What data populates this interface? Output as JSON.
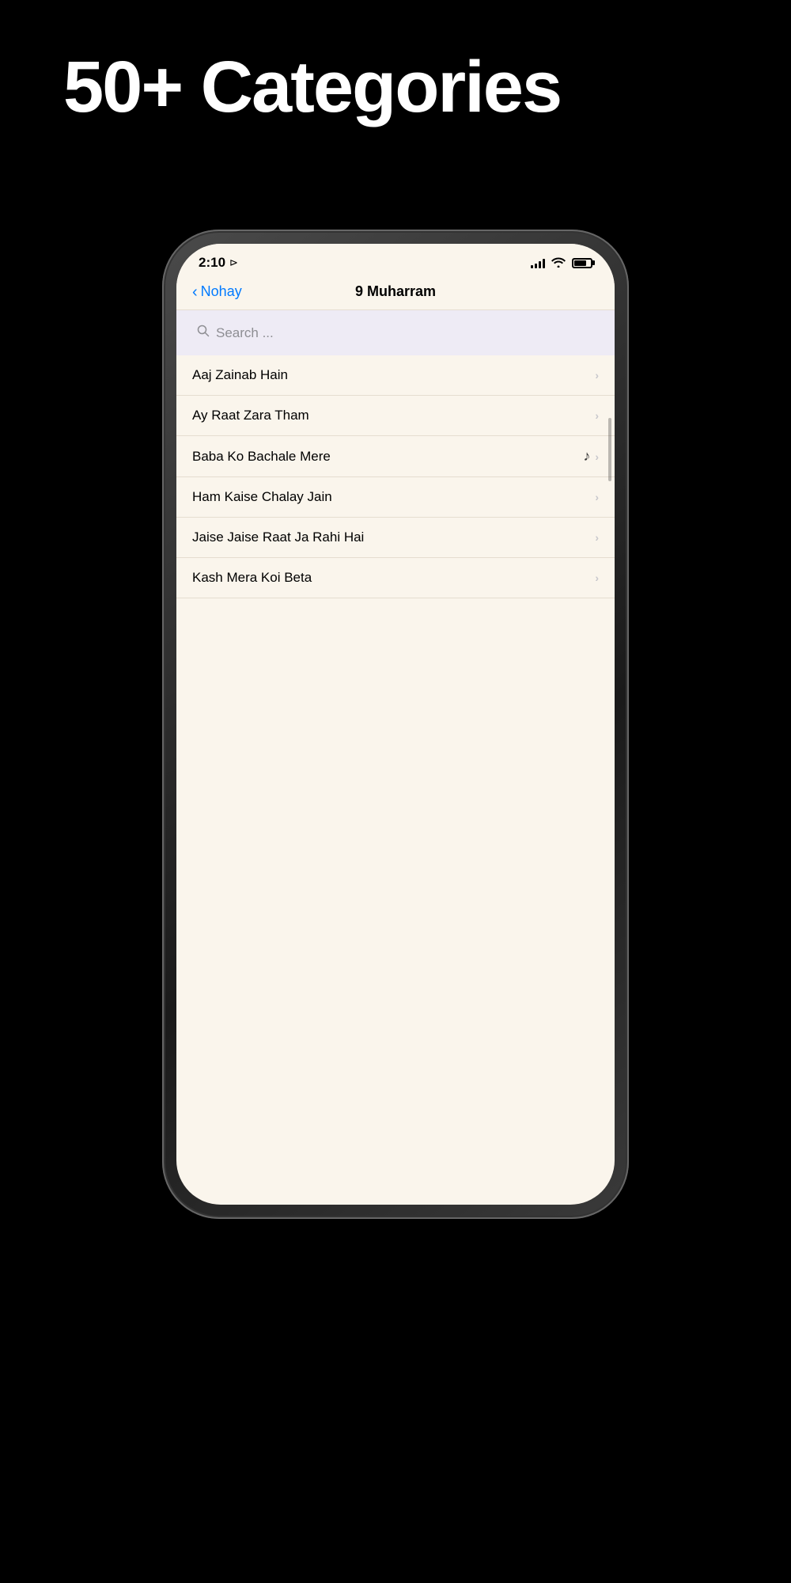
{
  "hero": {
    "title": "50+ Categories"
  },
  "status_bar": {
    "time": "2:10",
    "location_icon": "◂",
    "signal_bars": [
      4,
      6,
      9,
      11,
      14
    ],
    "wifi": "wifi",
    "battery": "battery"
  },
  "nav": {
    "back_label": "Nohay",
    "title": "9 Muharram"
  },
  "search": {
    "placeholder": "Search ..."
  },
  "list_items": [
    {
      "id": 1,
      "label": "Aaj Zainab Hain",
      "playing": false
    },
    {
      "id": 2,
      "label": "Ay Raat Zara Tham",
      "playing": false
    },
    {
      "id": 3,
      "label": "Baba Ko Bachale Mere",
      "playing": true
    },
    {
      "id": 4,
      "label": "Ham Kaise Chalay Jain",
      "playing": false
    },
    {
      "id": 5,
      "label": "Jaise Jaise Raat Ja Rahi Hai",
      "playing": false
    },
    {
      "id": 6,
      "label": "Kash Mera Koi Beta",
      "playing": false
    }
  ],
  "colors": {
    "background": "#000000",
    "screen_bg": "#faf5ec",
    "search_bg": "#eeebf5",
    "accent_blue": "#007AFF",
    "text_primary": "#000000",
    "text_secondary": "#8e8e93",
    "divider": "#e5ddd0",
    "chevron": "#c7c7cc"
  }
}
